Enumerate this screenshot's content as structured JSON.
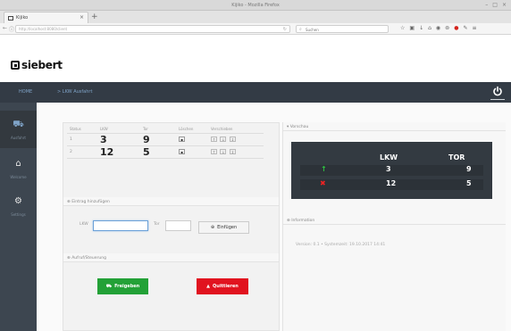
{
  "browser": {
    "window_title": "Kijiko - Mozilla Firefox",
    "tab_label": "Kijiko",
    "url": "http://localhost:8080/client",
    "search_placeholder": "Suchen"
  },
  "app": {
    "logo": "siebert",
    "topbar": {
      "home": "HOME",
      "breadcrumb": "> LKW Ausfahrt"
    },
    "sidebar": [
      {
        "icon": "truck-icon",
        "label": "Ausfahrt"
      },
      {
        "icon": "home-icon",
        "label": "Welcome"
      },
      {
        "icon": "gears-icon",
        "label": "Settings"
      }
    ]
  },
  "list": {
    "columns": [
      "Status",
      "LKW",
      "Tor",
      "Löschen",
      "Verschieben"
    ],
    "rows": [
      {
        "status": "1",
        "lkw": "3",
        "tor": "9"
      },
      {
        "status": "2",
        "lkw": "12",
        "tor": "5"
      }
    ]
  },
  "add_entry": {
    "heading": "Eintrag hinzufügen",
    "lkw_label": "LKW",
    "lkw_value": "",
    "tor_label": "Tor",
    "tor_value": "",
    "button_label": "Einfügen"
  },
  "release": {
    "heading": "Aufruf/Steuerung",
    "green_label": "Freigeben",
    "red_label": "Quittieren"
  },
  "preview": {
    "heading": "Vorschau",
    "col_lkw": "LKW",
    "col_tor": "TOR",
    "rows": [
      {
        "arrow": "↑",
        "lkw": "3",
        "tor": "9"
      },
      {
        "arrow": "✖",
        "lkw": "12",
        "tor": "5"
      }
    ]
  },
  "info": {
    "heading": "Information",
    "text": "Version: 0.1  •  Systemzeit: 19.10.2017 14:41"
  },
  "colors": {
    "topbar": "#333b45",
    "sidebar": "#3d4650",
    "board": "#333a41",
    "green": "#23a137",
    "red": "#e1131f"
  }
}
